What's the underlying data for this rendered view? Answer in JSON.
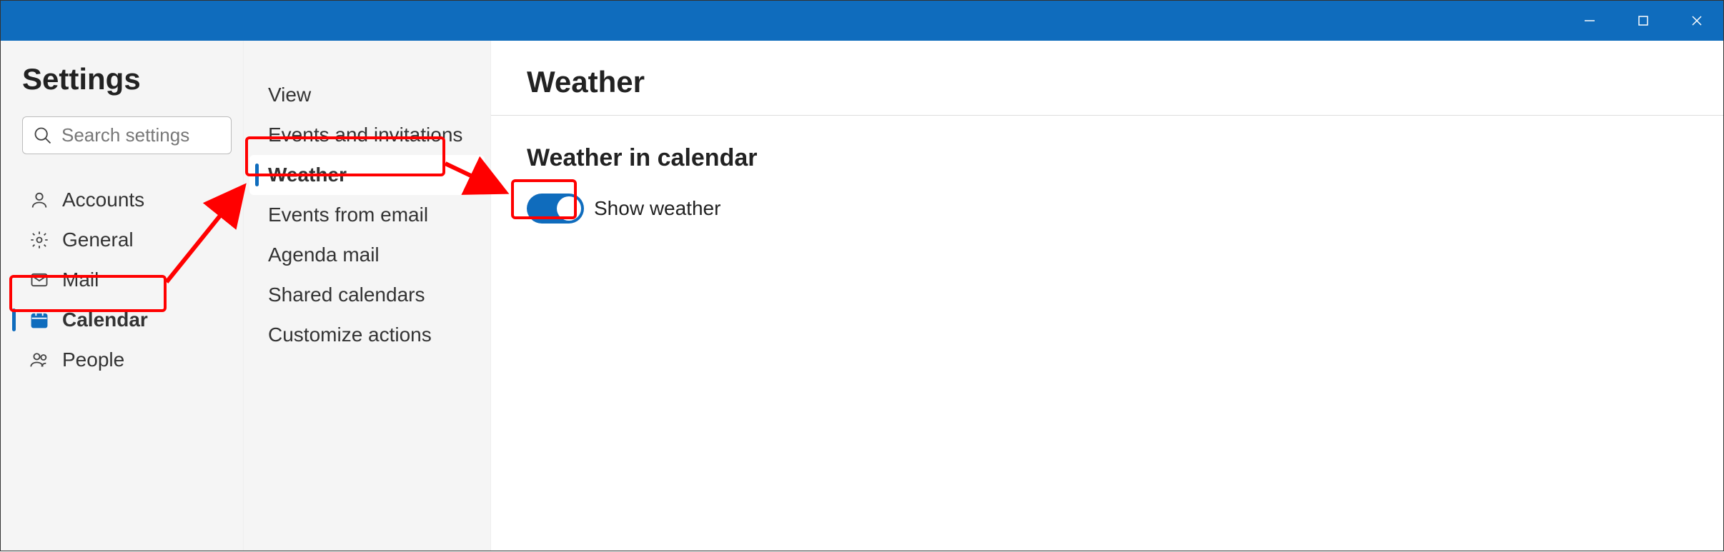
{
  "titlebar": {
    "minimize_label": "Minimize",
    "maximize_label": "Maximize",
    "close_label": "Close"
  },
  "sidebar": {
    "title": "Settings",
    "search_placeholder": "Search settings",
    "items": [
      {
        "icon": "person",
        "label": "Accounts",
        "active": false
      },
      {
        "icon": "gear",
        "label": "General",
        "active": false
      },
      {
        "icon": "mail",
        "label": "Mail",
        "active": false
      },
      {
        "icon": "calendar",
        "label": "Calendar",
        "active": true
      },
      {
        "icon": "people",
        "label": "People",
        "active": false
      }
    ]
  },
  "subnav": {
    "items": [
      {
        "label": "View",
        "active": false
      },
      {
        "label": "Events and invitations",
        "active": false
      },
      {
        "label": "Weather",
        "active": true
      },
      {
        "label": "Events from email",
        "active": false
      },
      {
        "label": "Agenda mail",
        "active": false
      },
      {
        "label": "Shared calendars",
        "active": false
      },
      {
        "label": "Customize actions",
        "active": false
      }
    ]
  },
  "main": {
    "title": "Weather",
    "section_title": "Weather in calendar",
    "toggle_label": "Show weather",
    "toggle_on": true
  },
  "annotations": {
    "highlight_calendar": true,
    "highlight_weather": true,
    "highlight_toggle": true
  }
}
